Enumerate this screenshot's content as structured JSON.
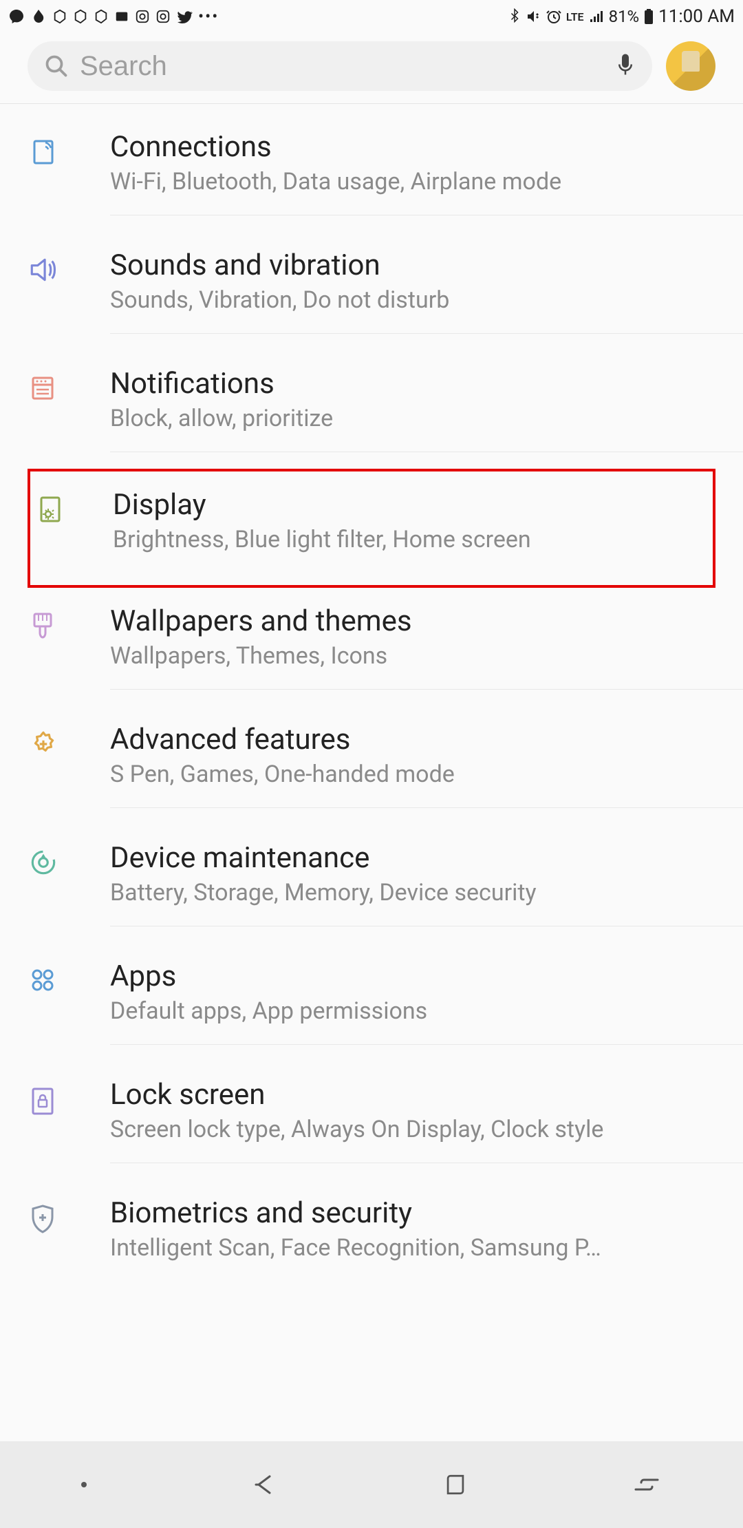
{
  "status_bar": {
    "battery": "81%",
    "time": "11:00 AM",
    "network": "LTE"
  },
  "search": {
    "placeholder": "Search"
  },
  "settings": [
    {
      "key": "connections",
      "title": "Connections",
      "subtitle": "Wi-Fi, Bluetooth, Data usage, Airplane mode",
      "icon_color": "#5a9bd4"
    },
    {
      "key": "sounds",
      "title": "Sounds and vibration",
      "subtitle": "Sounds, Vibration, Do not disturb",
      "icon_color": "#7b86d8"
    },
    {
      "key": "notifications",
      "title": "Notifications",
      "subtitle": "Block, allow, prioritize",
      "icon_color": "#e89082"
    },
    {
      "key": "display",
      "title": "Display",
      "subtitle": "Brightness, Blue light filter, Home screen",
      "icon_color": "#8fa84f",
      "highlight": true
    },
    {
      "key": "wallpapers",
      "title": "Wallpapers and themes",
      "subtitle": "Wallpapers, Themes, Icons",
      "icon_color": "#c79ad4"
    },
    {
      "key": "advanced",
      "title": "Advanced features",
      "subtitle": "S Pen, Games, One-handed mode",
      "icon_color": "#e0a847"
    },
    {
      "key": "device",
      "title": "Device maintenance",
      "subtitle": "Battery, Storage, Memory, Device security",
      "icon_color": "#5fb9a0"
    },
    {
      "key": "apps",
      "title": "Apps",
      "subtitle": "Default apps, App permissions",
      "icon_color": "#5a9bd4"
    },
    {
      "key": "lock",
      "title": "Lock screen",
      "subtitle": "Screen lock type, Always On Display, Clock style",
      "icon_color": "#9b8cd4"
    },
    {
      "key": "biometrics",
      "title": "Biometrics and security",
      "subtitle": "Intelligent Scan, Face Recognition, Samsung P…",
      "icon_color": "#8a96a8"
    }
  ]
}
